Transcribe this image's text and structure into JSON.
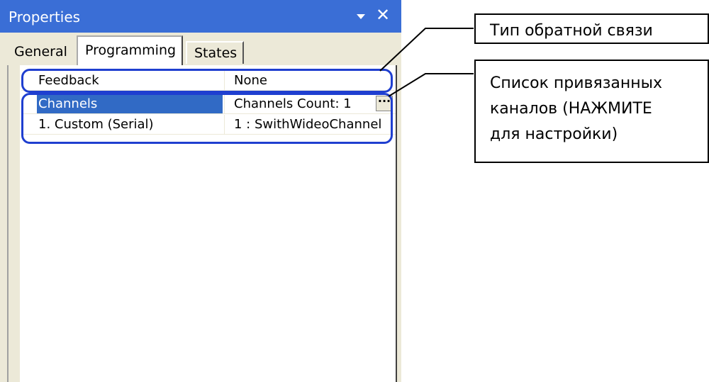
{
  "panel": {
    "title": "Properties",
    "tabs": [
      {
        "label": "General"
      },
      {
        "label": "Programming"
      },
      {
        "label": "States"
      }
    ]
  },
  "grid": {
    "rows": [
      {
        "name": "Feedback",
        "value": "None"
      },
      {
        "name": "Channels",
        "value": "Channels Count: 1",
        "button": "···"
      },
      {
        "name": "1. Custom (Serial)",
        "value": "1 : SwithWideoChannel"
      }
    ]
  },
  "callouts": {
    "feedback": "Тип обратной связи",
    "channels_line1": "Список привязанных",
    "channels_line2": "каналов (НАЖМИТЕ",
    "channels_line3": "для настройки)"
  },
  "colors": {
    "titlebar": "#3a6ed6",
    "selection": "#316ac5",
    "highlight": "#1f3fd0"
  }
}
